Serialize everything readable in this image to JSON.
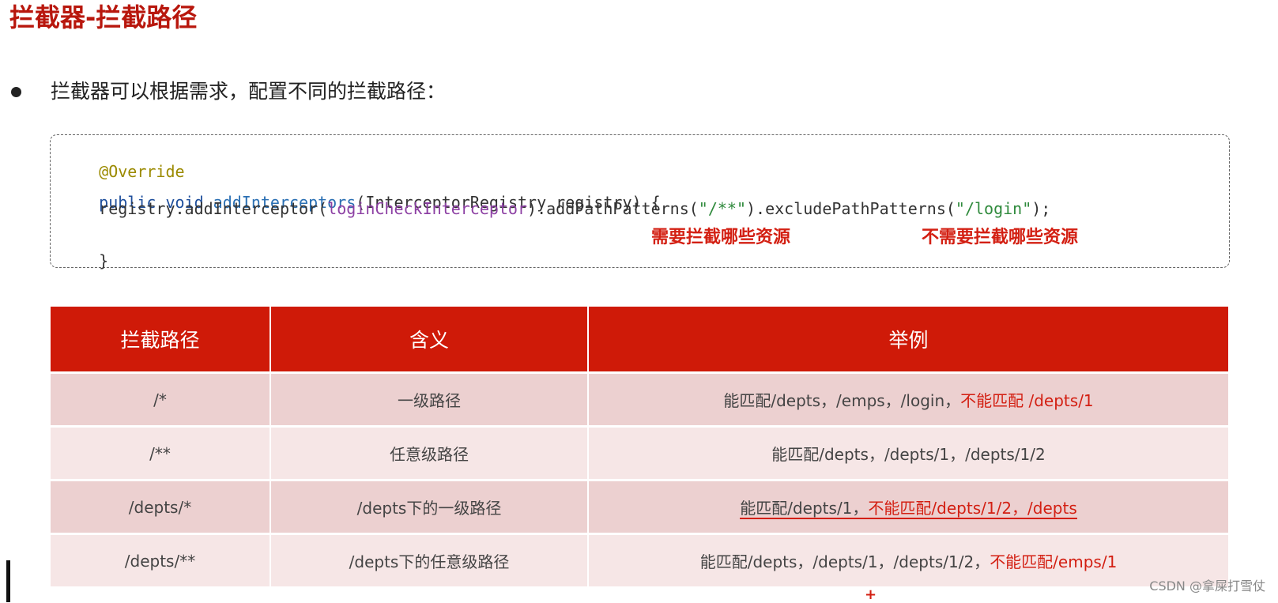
{
  "slide": {
    "title": "拦截器-拦截路径",
    "bullet": "拦截器可以根据需求，配置不同的拦截路径："
  },
  "code": {
    "annotation": "@Override",
    "line2_kw": "public void",
    "line2_method": "addInterceptors",
    "line2_rest": "(InterceptorRegistry registry) {",
    "line3_a": "    registry.addInterceptor(",
    "line3_field": "loginCheckInterceptor",
    "line3_b": ").addPathPatterns(",
    "line3_str1": "\"/**\"",
    "line3_c": ").excludePathPatterns(",
    "line3_str2": "\"/login\"",
    "line3_d": ");",
    "closing": "}"
  },
  "annotations": {
    "include_label": "需要拦截哪些资源",
    "exclude_label": "不需要拦截哪些资源"
  },
  "table": {
    "headers": [
      "拦截路径",
      "含义",
      "举例"
    ],
    "rows": [
      {
        "path": "/*",
        "meaning": "一级路径",
        "example_plain": "能匹配/depts，/emps，/login，",
        "example_red": "不能匹配 /depts/1"
      },
      {
        "path": "/**",
        "meaning": "任意级路径",
        "example_plain": "能匹配/depts，/depts/1，/depts/1/2",
        "example_red": ""
      },
      {
        "path": "/depts/*",
        "meaning": "/depts下的一级路径",
        "example_plain": "能匹配/depts/1，",
        "example_red": "不能匹配/depts/1/2，/depts"
      },
      {
        "path": "/depts/**",
        "meaning": "/depts下的任意级路径",
        "example_plain": "能匹配/depts，/depts/1，/depts/1/2，",
        "example_red": "不能匹配/emps/1"
      }
    ]
  },
  "overlay": {
    "plus": "+",
    "watermark": "CSDN @拿屎打雪仗"
  }
}
